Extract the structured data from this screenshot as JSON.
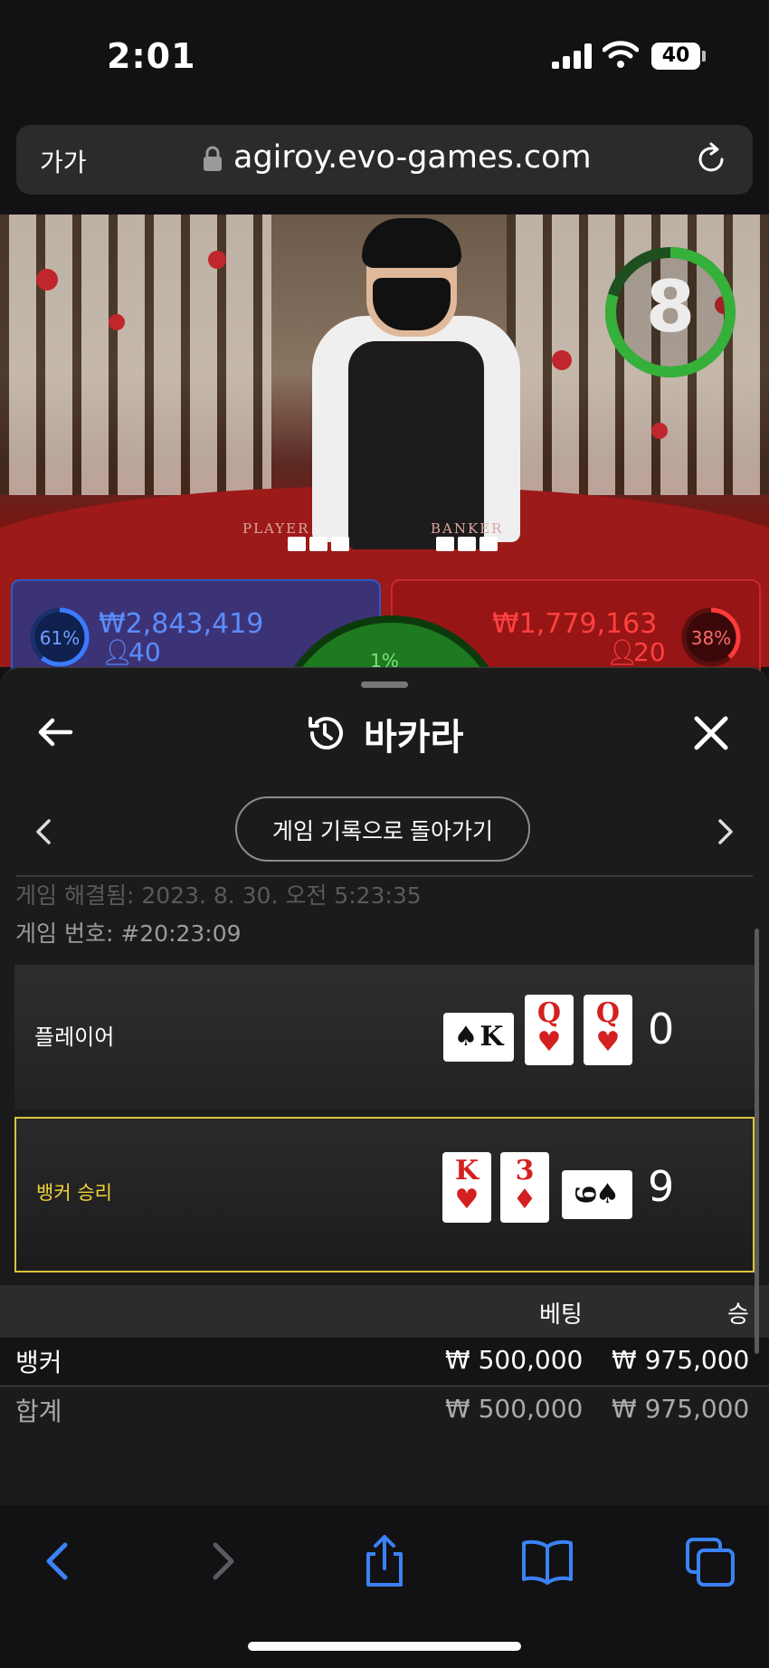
{
  "status_bar": {
    "time": "2:01",
    "battery": "40"
  },
  "browser": {
    "text_size_label": "가가",
    "url": "agiroy.evo-games.com"
  },
  "live_video": {
    "countdown": "8",
    "table_labels": {
      "player": "PLAYER",
      "banker": "BANKER"
    },
    "player_bets": {
      "percent": "61%",
      "amount": "₩2,843,419",
      "players": "40"
    },
    "banker_bets": {
      "percent": "38%",
      "amount": "₩1,779,163",
      "players": "20"
    },
    "tie_bets": {
      "percent": "1%"
    }
  },
  "history": {
    "title": "바카라",
    "return_label": "게임 기록으로 돌아가기",
    "resolved_text": "게임 해결됨: 2023. 8. 30. 오전 5:23:35",
    "game_number": "게임 번호: #20:23:09",
    "player": {
      "label": "플레이어",
      "score": "0",
      "cards": [
        {
          "rank": "K",
          "suit": "♠",
          "color": "black",
          "orientation": "sideways"
        },
        {
          "rank": "Q",
          "suit": "♥",
          "color": "red",
          "orientation": "upright"
        },
        {
          "rank": "Q",
          "suit": "♥",
          "color": "red",
          "orientation": "upright"
        }
      ]
    },
    "banker": {
      "label": "뱅커 승리",
      "score": "9",
      "cards": [
        {
          "rank": "K",
          "suit": "♥",
          "color": "red",
          "orientation": "upright"
        },
        {
          "rank": "3",
          "suit": "♦",
          "color": "red",
          "orientation": "upright"
        },
        {
          "rank": "9",
          "suit": "♠",
          "color": "black",
          "orientation": "sideways"
        }
      ]
    },
    "bets_table": {
      "headers": {
        "bet": "베팅",
        "win": "승"
      },
      "rows": [
        {
          "name": "뱅커",
          "bet": "₩ 500,000",
          "win": "₩ 975,000"
        },
        {
          "name": "합계",
          "bet": "₩ 500,000",
          "win": "₩ 975,000"
        }
      ]
    }
  },
  "colors": {
    "accent_gold": "#d9c43a",
    "player_blue": "#2d59c7",
    "banker_red": "#c62a2a",
    "timer_green": "#35b13a",
    "ios_blue": "#3b82f6"
  },
  "icons": {
    "back": "arrow-left-icon",
    "history": "history-icon",
    "close": "close-icon",
    "prev": "chevron-left-icon",
    "next": "chevron-right-icon",
    "toolbar": [
      "back-chevron-icon",
      "forward-chevron-icon",
      "share-icon",
      "bookmarks-icon",
      "tabs-icon"
    ]
  }
}
